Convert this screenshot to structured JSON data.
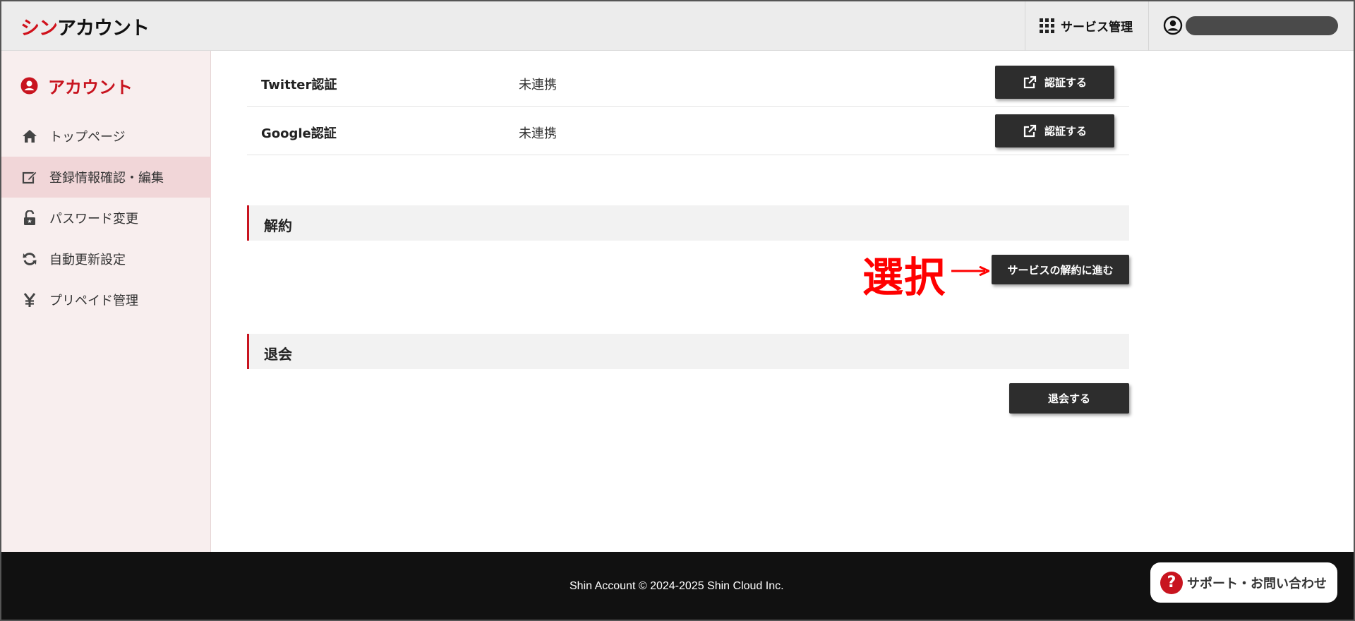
{
  "header": {
    "logo_part1": "シン",
    "logo_part2": "アカウント",
    "services_label": "サービス管理",
    "user_name": ""
  },
  "sidebar": {
    "title": "アカウント",
    "items": [
      {
        "label": "トップページ",
        "icon": "home-icon",
        "active": false
      },
      {
        "label": "登録情報確認・編集",
        "icon": "edit-icon",
        "active": true
      },
      {
        "label": "パスワード変更",
        "icon": "unlock-icon",
        "active": false
      },
      {
        "label": "自動更新設定",
        "icon": "refresh-icon",
        "active": false
      },
      {
        "label": "プリペイド管理",
        "icon": "yen-icon",
        "active": false
      }
    ]
  },
  "main": {
    "auth_rows": [
      {
        "label": "Twitter認証",
        "status": "未連携",
        "button": "認証する"
      },
      {
        "label": "Google認証",
        "status": "未連携",
        "button": "認証する"
      }
    ],
    "cancel_section": {
      "heading": "解約",
      "button": "サービスの解約に進む",
      "annotation": "選択"
    },
    "withdraw_section": {
      "heading": "退会",
      "button": "退会する"
    }
  },
  "footer": {
    "copyright": "Shin Account © 2024-2025 Shin Cloud Inc.",
    "support_label": "サポート・お問い合わせ",
    "support_icon_text": "?"
  },
  "colors": {
    "brand_red": "#c8141f",
    "annotation_red": "#ff0000",
    "dark_button": "#2d2d2d",
    "sidebar_bg": "#f8eeee",
    "sidebar_active": "#f1d6d8",
    "footer_bg": "#111111"
  }
}
